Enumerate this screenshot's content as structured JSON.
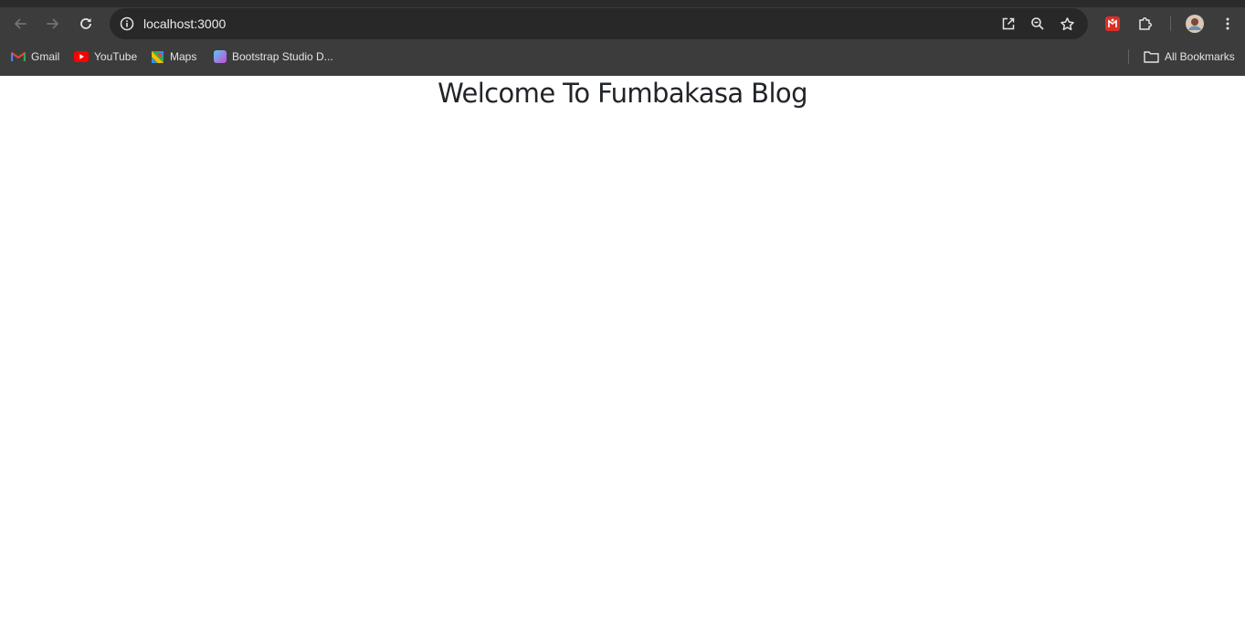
{
  "browser": {
    "address_bar": {
      "url": "localhost:3000"
    },
    "bookmarks": [
      {
        "label": "Gmail",
        "icon": "gmail-icon"
      },
      {
        "label": "YouTube",
        "icon": "youtube-icon"
      },
      {
        "label": "Maps",
        "icon": "maps-icon"
      },
      {
        "label": "Bootstrap Studio D...",
        "icon": "bootstrap-studio-icon"
      }
    ],
    "all_bookmarks_label": "All Bookmarks",
    "colors": {
      "frame": "#3c3c3c",
      "omnibox": "#282828",
      "text": "#e8eaed"
    }
  },
  "page": {
    "heading": "Welcome To Fumbakasa Blog",
    "heading_color": "#212529"
  }
}
